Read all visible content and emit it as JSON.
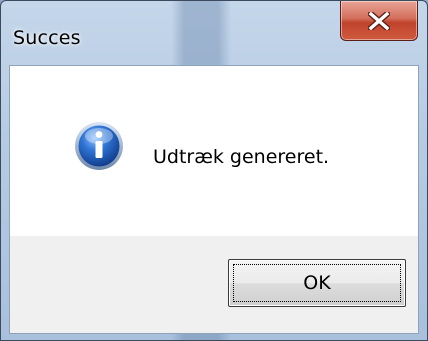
{
  "window": {
    "title": "Succes"
  },
  "titlebar": {
    "close_icon": "close-x-icon"
  },
  "dialog": {
    "icon": "information-icon",
    "message": "Udtræk genereret.",
    "ok_label": "OK"
  },
  "colors": {
    "close_button": "#c74a33",
    "info_icon": "#1f5fb8",
    "content_background": "#ffffff",
    "footer_background": "#f0f0f0"
  }
}
